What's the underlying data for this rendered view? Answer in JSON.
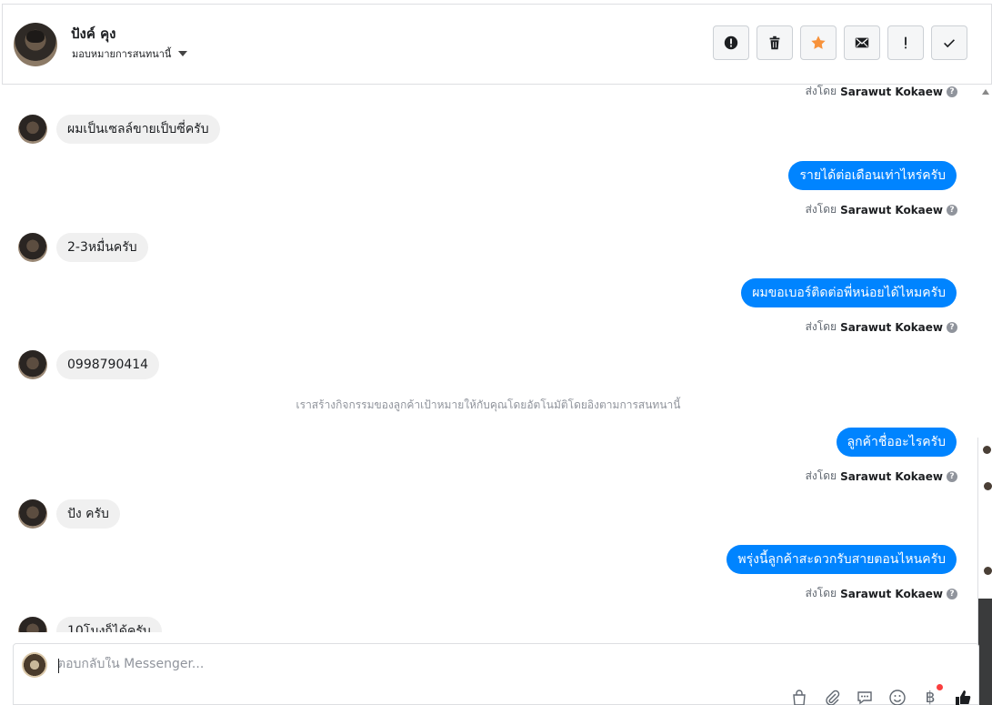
{
  "header": {
    "contact_name": "ปังค์ คุง",
    "assign_label": "มอบหมายการสนทนานี้",
    "toolbar": [
      {
        "name": "mark-spam-button",
        "icon": "alert-circle-icon"
      },
      {
        "name": "delete-button",
        "icon": "trash-icon"
      },
      {
        "name": "star-button",
        "icon": "star-icon"
      },
      {
        "name": "mark-unread-button",
        "icon": "envelope-icon"
      },
      {
        "name": "follow-up-button",
        "icon": "exclamation-icon"
      },
      {
        "name": "mark-done-button",
        "icon": "checkmark-icon"
      }
    ]
  },
  "messages": {
    "sent_by_prefix": "ส่งโดย",
    "agent_name": "Sarawut Kokaew",
    "help_glyph": "?",
    "in_1": "ผมเป็นเซลล์ขายเป็บซี่ครับ",
    "out_1": "รายได้ต่อเดือนเท่าไหร่ครับ",
    "in_2": "2-3หมื่นครับ",
    "out_2": "ผมขอเบอร์ติดต่อพี่หน่อยได้ไหมครับ",
    "in_3": "0998790414",
    "system_note": "เราสร้างกิจกรรมของลูกค้าเป้าหมายให้กับคุณโดยอัตโนมัติโดยอิงตามการสนทนานี้",
    "out_3": "ลูกค้าชื่ออะไรครับ",
    "in_4": "ปัง ครับ",
    "out_4": "พรุ่งนี้ลูกค้าสะดวกรับสายตอนไหนครับ",
    "in_5": "10โมงก็ได้ครับ"
  },
  "composer": {
    "placeholder": "ตอบกลับใน Messenger...",
    "tools": [
      "shopping-bag-icon",
      "paperclip-icon",
      "saved-reply-icon",
      "emoji-icon",
      "baht-payment-icon",
      "thumbs-up-icon"
    ],
    "baht_symbol": "฿"
  },
  "colors": {
    "outgoing_bubble": "#0084ff",
    "incoming_bubble": "#f0f0f0",
    "star": "#f7923b"
  }
}
